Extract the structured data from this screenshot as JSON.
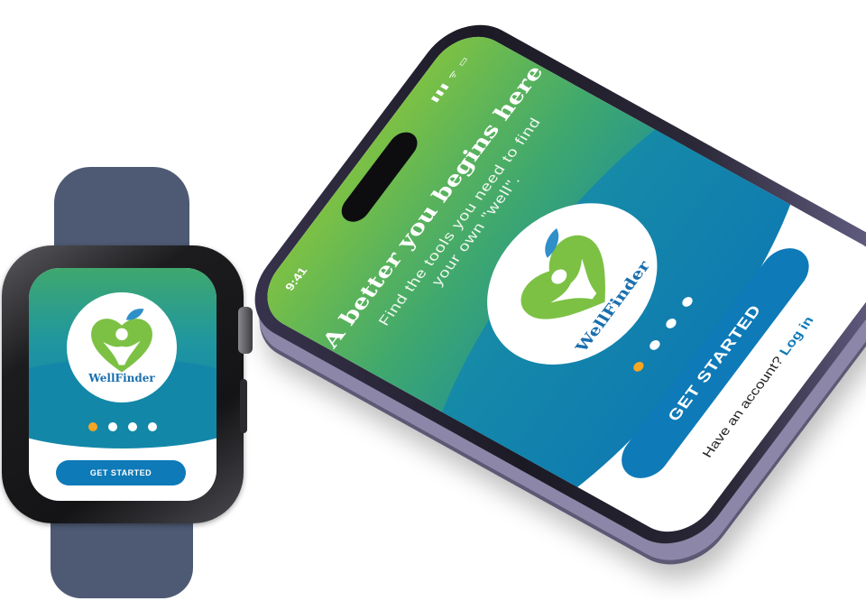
{
  "app": {
    "name": "WellFinder"
  },
  "colors": {
    "brand_green": "#7cc144",
    "brand_teal": "#1387a8",
    "brand_blue": "#0e7ab8",
    "active_dot": "#f5a623"
  },
  "phone": {
    "status_time": "9:41",
    "status_icons": "▮▮▮ ᯤ ▭",
    "title": "A better you begins here",
    "subtitle": "Find the tools you need to find your own \"well\".",
    "logo_text": "WellFinder",
    "pager": {
      "count": 4,
      "active_index": 0
    },
    "cta_label": "GET STARTED",
    "login_prompt": "Have an account?",
    "login_link": "Log in"
  },
  "watch": {
    "logo_text": "WellFinder",
    "pager": {
      "count": 4,
      "active_index": 0
    },
    "cta_label": "GET STARTED"
  }
}
